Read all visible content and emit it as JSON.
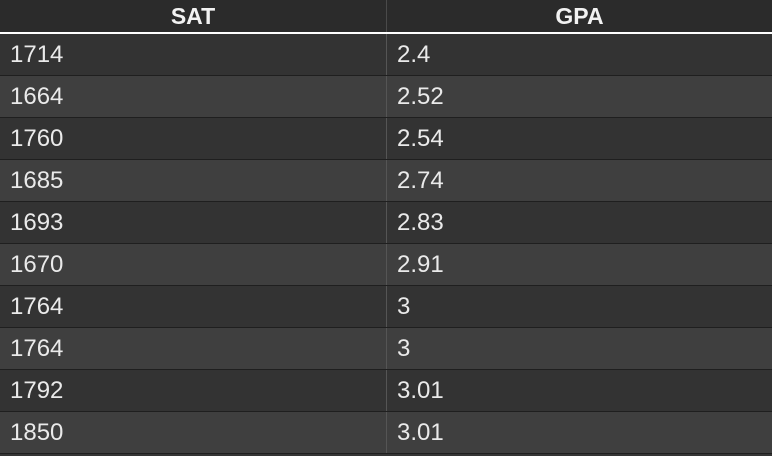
{
  "table": {
    "headers": [
      "SAT",
      "GPA"
    ],
    "rows": [
      [
        "1714",
        "2.4"
      ],
      [
        "1664",
        "2.52"
      ],
      [
        "1760",
        "2.54"
      ],
      [
        "1685",
        "2.74"
      ],
      [
        "1693",
        "2.83"
      ],
      [
        "1670",
        "2.91"
      ],
      [
        "1764",
        "3"
      ],
      [
        "1764",
        "3"
      ],
      [
        "1792",
        "3.01"
      ],
      [
        "1850",
        "3.01"
      ]
    ]
  },
  "colors": {
    "background": "#353535",
    "header_background": "#2b2b2b",
    "row_odd": "#333333",
    "row_even": "#3f3f3f",
    "text": "#eaeaea",
    "header_rule": "#ffffff"
  }
}
